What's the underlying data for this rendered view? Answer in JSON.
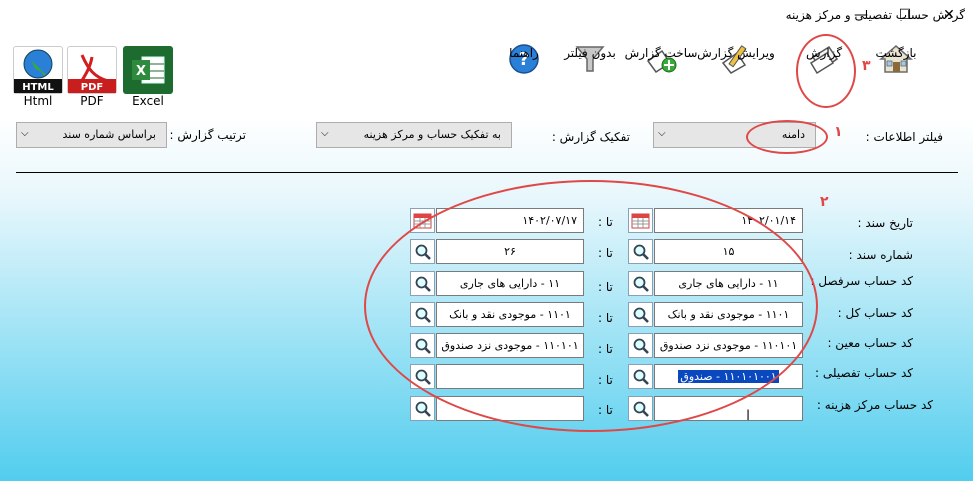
{
  "window": {
    "title": "گردش حساب تفصیلی و مرکز هزینه",
    "minimize": "—",
    "maximize": "☐",
    "close": "✕"
  },
  "toolbar": {
    "back": "بازگشت",
    "report": "گزارش",
    "edit_report": "ویرایش گزارش",
    "build_report": "ساخت گزارش",
    "no_filter": "بدون فیلتر",
    "help": "راهنما",
    "excel": "Excel",
    "pdf": "PDF",
    "html": "Html"
  },
  "filters": {
    "scope_label": "فیلتر اطلاعات :",
    "scope_value": "دامنه",
    "split_label": "تفکیک گزارش :",
    "split_value": "به تفکیک حساب و مرکز هزینه",
    "sort_label": "ترتیب گزارش :",
    "sort_value": "براساس شماره سند"
  },
  "form": {
    "to_label": "تا :",
    "rows": [
      {
        "label": "تاریخ سند :",
        "from": "۱۴۰۲/۰۱/۱۴",
        "to": "۱۴۰۲/۰۷/۱۷"
      },
      {
        "label": "شماره سند :",
        "from": "۱۵",
        "to": "۲۶"
      },
      {
        "label": "کد حساب سرفصل :",
        "from": "۱۱ - دارایی های جاری",
        "to": "۱۱ - دارایی های جاری"
      },
      {
        "label": "کد حساب کل :",
        "from": "۱۱۰۱ - موجودی نقد و بانک",
        "to": "۱۱۰۱ - موجودی نقد و بانک"
      },
      {
        "label": "کد حساب معین :",
        "from": "۱۱۰۱۰۱ - موجودی نزد صندوق",
        "to": "۱۱۰۱۰۱ - موجودی نزد صندوق"
      },
      {
        "label": "کد حساب تفصیلی :",
        "from": "۱۱۰۱۰۱۰۰۱ - صندوق",
        "to": ""
      },
      {
        "label": "کد حساب مرکز هزینه :",
        "from": "",
        "to": ""
      }
    ]
  },
  "annotations": {
    "n1": "۱",
    "n2": "۲",
    "n3": "۳"
  },
  "colors": {
    "accent": "#0a48c0",
    "annotation": "#e04848"
  }
}
